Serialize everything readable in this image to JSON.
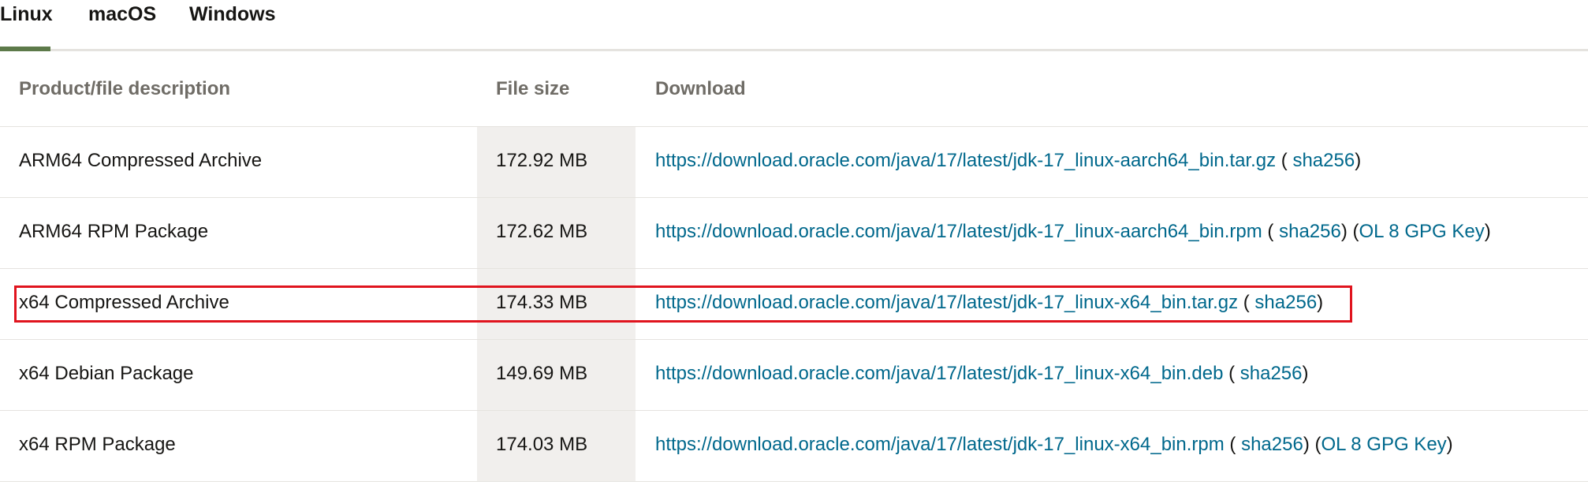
{
  "tabs": [
    {
      "label": "Linux",
      "active": true
    },
    {
      "label": "macOS",
      "active": false
    },
    {
      "label": "Windows",
      "active": false
    }
  ],
  "table": {
    "headers": {
      "description": "Product/file description",
      "file_size": "File size",
      "download": "Download"
    },
    "rows": [
      {
        "description": "ARM64 Compressed Archive",
        "file_size": "172.92 MB",
        "url": "https://download.oracle.com/java/17/latest/jdk-17_linux-aarch64_bin.tar.gz",
        "sha_prefix": " ( ",
        "sha_label": "sha256",
        "sha_suffix": ")",
        "gpg_prefix": "",
        "gpg_label": "",
        "gpg_suffix": ""
      },
      {
        "description": "ARM64 RPM Package",
        "file_size": "172.62 MB",
        "url": "https://download.oracle.com/java/17/latest/jdk-17_linux-aarch64_bin.rpm",
        "sha_prefix": " ( ",
        "sha_label": "sha256",
        "sha_suffix": ") ",
        "gpg_prefix": "(",
        "gpg_label": "OL 8 GPG Key",
        "gpg_suffix": ")"
      },
      {
        "description": "x64 Compressed Archive",
        "file_size": "174.33 MB",
        "url": "https://download.oracle.com/java/17/latest/jdk-17_linux-x64_bin.tar.gz",
        "sha_prefix": " ( ",
        "sha_label": "sha256",
        "sha_suffix": ")",
        "gpg_prefix": "",
        "gpg_label": "",
        "gpg_suffix": ""
      },
      {
        "description": "x64 Debian Package",
        "file_size": "149.69 MB",
        "url": "https://download.oracle.com/java/17/latest/jdk-17_linux-x64_bin.deb",
        "sha_prefix": " ( ",
        "sha_label": "sha256",
        "sha_suffix": ")",
        "gpg_prefix": "",
        "gpg_label": "",
        "gpg_suffix": ""
      },
      {
        "description": "x64 RPM Package",
        "file_size": "174.03 MB",
        "url": "https://download.oracle.com/java/17/latest/jdk-17_linux-x64_bin.rpm",
        "sha_prefix": " ( ",
        "sha_label": "sha256",
        "sha_suffix": ") ",
        "gpg_prefix": "(",
        "gpg_label": "OL 8 GPG Key",
        "gpg_suffix": ")"
      }
    ]
  },
  "colors": {
    "link": "#00688c",
    "active_tab_underline": "#5d7a4a",
    "highlight_border": "#e0141e",
    "file_size_column_bg": "#f1efed"
  }
}
